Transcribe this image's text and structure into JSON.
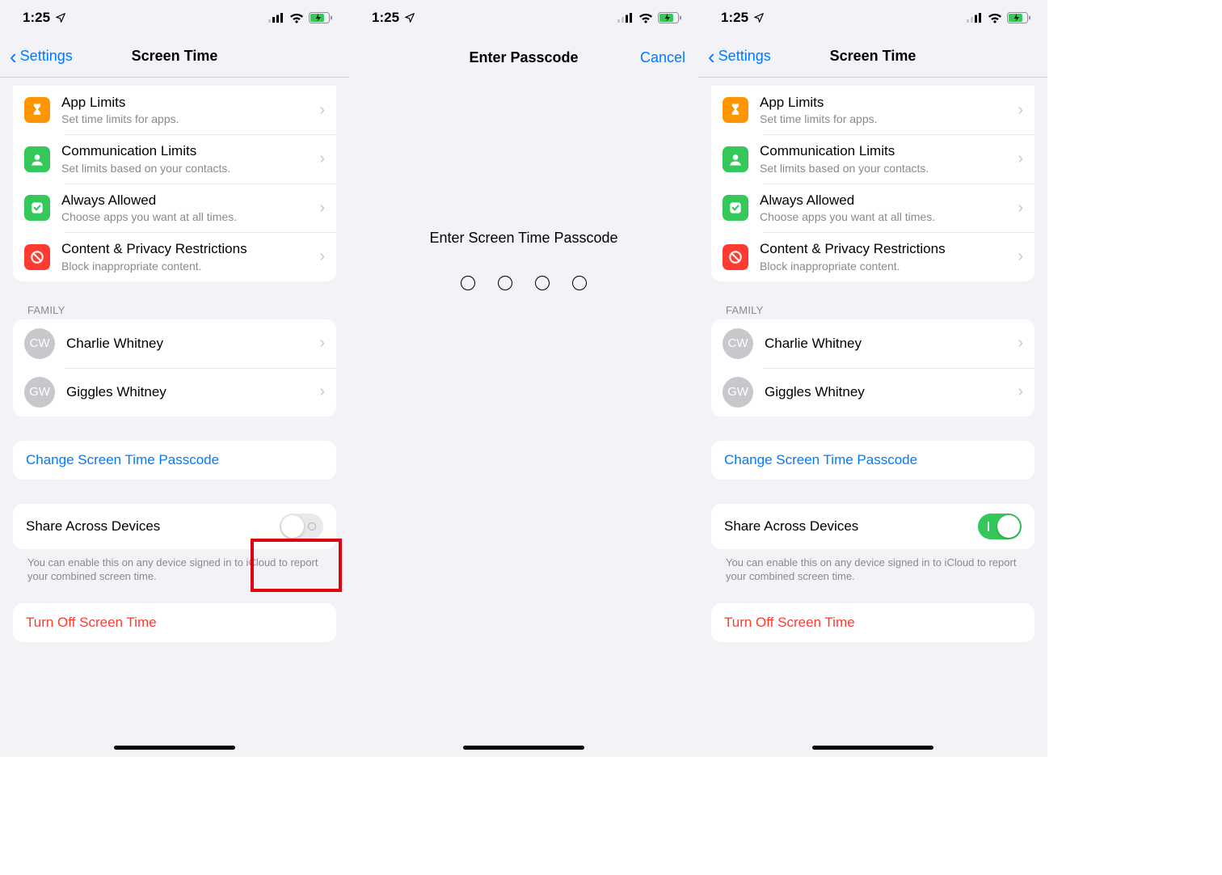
{
  "status": {
    "time": "1:25"
  },
  "screen1": {
    "back_label": "Settings",
    "title": "Screen Time",
    "rows": {
      "app_limits": {
        "title": "App Limits",
        "sub": "Set time limits for apps."
      },
      "comm_limits": {
        "title": "Communication Limits",
        "sub": "Set limits based on your contacts."
      },
      "always_allowed": {
        "title": "Always Allowed",
        "sub": "Choose apps you want at all times."
      },
      "content_privacy": {
        "title": "Content & Privacy Restrictions",
        "sub": "Block inappropriate content."
      }
    },
    "family_header": "FAMILY",
    "family": [
      {
        "initials": "CW",
        "name": "Charlie Whitney"
      },
      {
        "initials": "GW",
        "name": "Giggles Whitney"
      }
    ],
    "change_passcode": "Change Screen Time Passcode",
    "share_label": "Share Across Devices",
    "share_on": false,
    "share_footer": "You can enable this on any device signed in to iCloud to report your combined screen time.",
    "turn_off": "Turn Off Screen Time"
  },
  "screen2": {
    "title": "Enter Passcode",
    "cancel": "Cancel",
    "prompt": "Enter Screen Time Passcode"
  },
  "screen3": {
    "back_label": "Settings",
    "title": "Screen Time",
    "rows": {
      "app_limits": {
        "title": "App Limits",
        "sub": "Set time limits for apps."
      },
      "comm_limits": {
        "title": "Communication Limits",
        "sub": "Set limits based on your contacts."
      },
      "always_allowed": {
        "title": "Always Allowed",
        "sub": "Choose apps you want at all times."
      },
      "content_privacy": {
        "title": "Content & Privacy Restrictions",
        "sub": "Block inappropriate content."
      }
    },
    "family_header": "FAMILY",
    "family": [
      {
        "initials": "CW",
        "name": "Charlie Whitney"
      },
      {
        "initials": "GW",
        "name": "Giggles Whitney"
      }
    ],
    "change_passcode": "Change Screen Time Passcode",
    "share_label": "Share Across Devices",
    "share_on": true,
    "share_footer": "You can enable this on any device signed in to iCloud to report your combined screen time.",
    "turn_off": "Turn Off Screen Time"
  }
}
